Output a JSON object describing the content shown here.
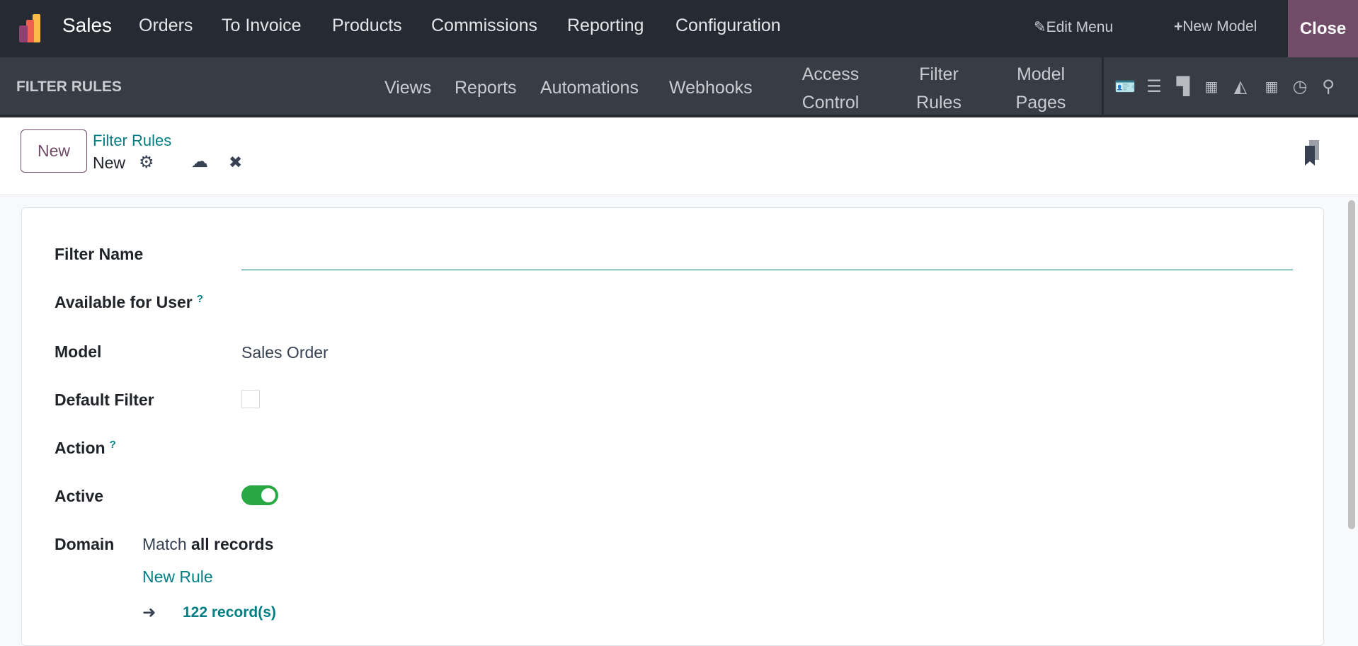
{
  "app": {
    "name": "Sales",
    "logo": "odoo-sales-logo"
  },
  "top_menu": [
    "Orders",
    "To Invoice",
    "Products",
    "Commissions",
    "Reporting",
    "Configuration"
  ],
  "studio": {
    "edit_menu": "Edit Menu",
    "new_model": "New Model",
    "close": "Close"
  },
  "sub_bar": {
    "title": "FILTER RULES",
    "items": [
      "Views",
      "Reports",
      "Automations",
      "Webhooks"
    ],
    "two_line": [
      [
        "Access",
        "Control"
      ],
      [
        "Filter",
        "Rules"
      ],
      [
        "Model",
        "Pages"
      ]
    ],
    "view_icons": [
      "kanban-card-icon",
      "list-icon",
      "kanban-icon",
      "calendar-icon",
      "graph-icon",
      "pivot-icon",
      "activity-clock-icon",
      "search-icon"
    ]
  },
  "control_panel": {
    "new_button": "New",
    "breadcrumb_parent": "Filter Rules",
    "breadcrumb_current": "New"
  },
  "form": {
    "filter_name": {
      "label": "Filter Name",
      "value": ""
    },
    "available_for_user": {
      "label": "Available for User",
      "help": "?"
    },
    "model": {
      "label": "Model",
      "value": "Sales Order"
    },
    "default_filter": {
      "label": "Default Filter",
      "checked": false
    },
    "action": {
      "label": "Action",
      "help": "?"
    },
    "active": {
      "label": "Active",
      "on": true
    },
    "domain": {
      "label": "Domain",
      "match_prefix": "Match",
      "match_bold": "all records",
      "new_rule": "New Rule",
      "records": "122 record(s)"
    }
  },
  "colors": {
    "topbar": "#262a33",
    "accent": "#714b67",
    "link": "#017e84",
    "toggle": "#28a745"
  }
}
